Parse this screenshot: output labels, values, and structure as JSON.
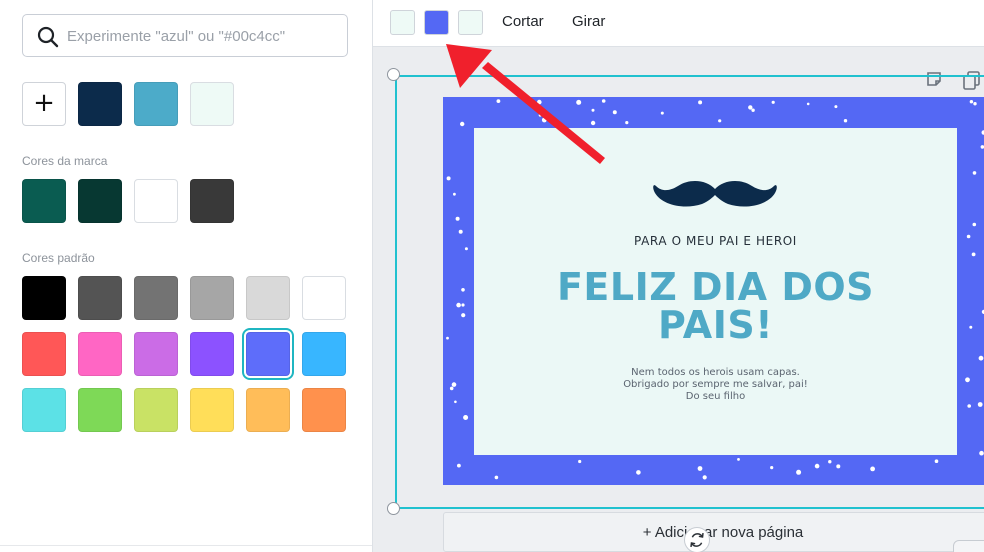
{
  "search": {
    "placeholder": "Experimente \"azul\" ou \"#00c4cc\""
  },
  "document_colors": {
    "add_label": "+",
    "swatches": [
      "#0c2b4b",
      "#4cabc9",
      "#eefaf6"
    ]
  },
  "brand_colors": {
    "label": "Cores da marca",
    "swatches": [
      "#0a5c51",
      "#073832",
      "#ffffff",
      "#393939"
    ]
  },
  "default_colors": {
    "label": "Cores padrão",
    "swatches": [
      "#000000",
      "#545454",
      "#737373",
      "#a6a6a6",
      "#d9d9d9",
      "#ffffff",
      "#ff5757",
      "#ff66c4",
      "#cb6ce6",
      "#8c52ff",
      "#5e6dfa",
      "#38b6ff",
      "#5ce1e6",
      "#7ed957",
      "#c9e265",
      "#ffde59",
      "#ffbd59",
      "#ff914d"
    ],
    "selected": "#5e6dfa"
  },
  "toolbar": {
    "swatches": [
      "#eefaf6",
      "#5468f4",
      "#eefaf6"
    ],
    "crop_label": "Cortar",
    "flip_label": "Girar"
  },
  "card": {
    "subtitle": "PARA O MEU PAI E HEROI",
    "title_line1": "FELIZ DIA DOS",
    "title_line2": "PAIS!",
    "message_line1": "Nem todos os herois usam capas.",
    "message_line2": "Obrigado por sempre me salvar, pai!",
    "message_line3": "Do seu filho"
  },
  "add_page_label": "+ Adicionar nova página",
  "colors": {
    "accent": "#20c1cf",
    "card_border": "#5468f4",
    "card_background": "#ebf8f6",
    "title": "#4fa9c6",
    "arrow": "#f0202c"
  },
  "icons": [
    "search-icon",
    "plus-icon",
    "duplicate-icon",
    "copy-icon",
    "rotate-icon",
    "mustache-icon",
    "arrow-annotation"
  ]
}
